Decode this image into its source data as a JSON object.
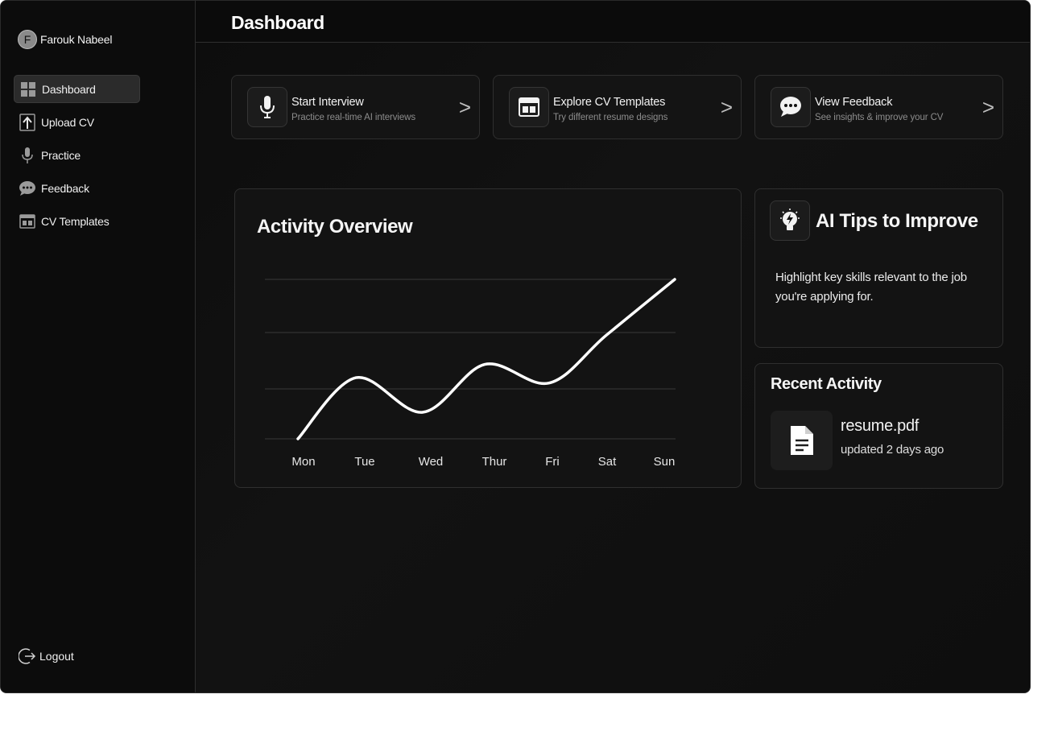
{
  "user": {
    "initial": "F",
    "name": "Farouk Nabeel"
  },
  "sidebar": {
    "items": [
      {
        "label": "Dashboard",
        "icon": "dashboard-grid-icon",
        "active": true
      },
      {
        "label": "Upload CV",
        "icon": "upload-icon"
      },
      {
        "label": "Practice",
        "icon": "microphone-icon"
      },
      {
        "label": "Feedback",
        "icon": "chat-bubble-icon"
      },
      {
        "label": "CV Templates",
        "icon": "template-icon"
      }
    ],
    "logout_label": "Logout"
  },
  "header": {
    "title": "Dashboard"
  },
  "actions": [
    {
      "title": "Start Interview",
      "subtitle": "Practice real-time AI interviews",
      "icon": "microphone-icon",
      "arrow": ">"
    },
    {
      "title": "Explore CV Templates",
      "subtitle": "Try different resume designs",
      "icon": "template-icon",
      "arrow": ">"
    },
    {
      "title": "View Feedback",
      "subtitle": "See insights & improve your CV",
      "icon": "chat-bubble-icon",
      "arrow": ">"
    }
  ],
  "activity": {
    "title": "Activity Overview"
  },
  "chart_data": {
    "type": "line",
    "categories": [
      "Mon",
      "Tue",
      "Wed",
      "Thur",
      "Fri",
      "Sat",
      "Sun"
    ],
    "series": [
      {
        "values": [
          0,
          2.3,
          1.0,
          2.8,
          2.1,
          3.9,
          6.0
        ]
      }
    ],
    "ylim": [
      0,
      6
    ],
    "grid": true,
    "line_color": "#ffffff"
  },
  "tips": {
    "title": "AI Tips to Improve",
    "text": "Highlight key skills relevant to the job you're applying for.",
    "icon": "lightbulb-bolt-icon"
  },
  "recent": {
    "title": "Recent Activity",
    "file_name": "resume.pdf",
    "updated": "updated 2 days ago",
    "icon": "document-icon"
  },
  "colors": {
    "background": "#0b0b0b",
    "panel": "#131313",
    "border": "#2f2f2f",
    "text": "#ffffff",
    "muted": "#8c8c8c"
  }
}
